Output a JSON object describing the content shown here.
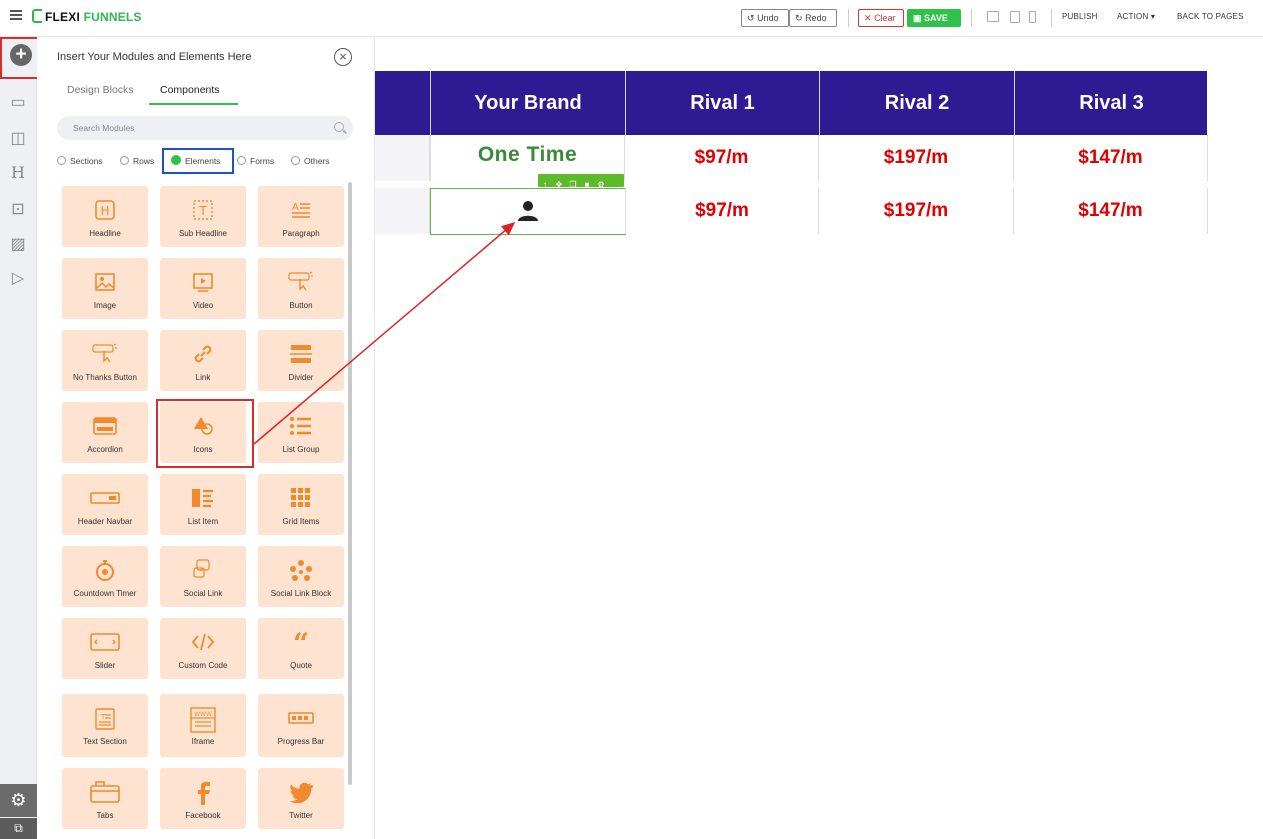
{
  "topbar": {
    "logo_flexi": "FLEXI",
    "logo_funnels": "FUNNELS",
    "undo": "Undo",
    "redo": "Redo",
    "clear": "Clear",
    "save": "SAVE",
    "publish": "PUBLISH",
    "action": "ACTION",
    "back": "BACK TO PAGES"
  },
  "panel": {
    "title": "Insert Your Modules and Elements Here",
    "tabs": [
      "Design Blocks",
      "Components"
    ],
    "active_tab": "Components",
    "search_placeholder": "Search Modules",
    "filters": [
      "Sections",
      "Rows",
      "Elements",
      "Forms",
      "Others"
    ],
    "active_filter": "Elements",
    "modules": [
      {
        "label": "Headline",
        "icon": "headline-icon"
      },
      {
        "label": "Sub Headline",
        "icon": "sub-headline-icon"
      },
      {
        "label": "Paragraph",
        "icon": "paragraph-icon"
      },
      {
        "label": "Image",
        "icon": "image-icon"
      },
      {
        "label": "Video",
        "icon": "video-icon"
      },
      {
        "label": "Button",
        "icon": "button-icon"
      },
      {
        "label": "No Thanks Button",
        "icon": "no-thanks-button-icon"
      },
      {
        "label": "Link",
        "icon": "link-icon"
      },
      {
        "label": "Divider",
        "icon": "divider-icon"
      },
      {
        "label": "Accordion",
        "icon": "accordion-icon"
      },
      {
        "label": "Icons",
        "icon": "shapes-icon"
      },
      {
        "label": "List Group",
        "icon": "list-group-icon"
      },
      {
        "label": "Header Navbar",
        "icon": "header-navbar-icon"
      },
      {
        "label": "List Item",
        "icon": "list-item-icon"
      },
      {
        "label": "Grid Items",
        "icon": "grid-icon"
      },
      {
        "label": "Countdown Timer",
        "icon": "timer-icon"
      },
      {
        "label": "Social Link",
        "icon": "social-link-icon"
      },
      {
        "label": "Social Link Block",
        "icon": "social-link-block-icon"
      },
      {
        "label": "Slider",
        "icon": "slider-icon"
      },
      {
        "label": "Custom Code",
        "icon": "code-icon"
      },
      {
        "label": "Quote",
        "icon": "quote-icon"
      },
      {
        "label": "Text Section",
        "icon": "text-section-icon"
      },
      {
        "label": "Iframe",
        "icon": "iframe-icon"
      },
      {
        "label": "Progress Bar",
        "icon": "progress-bar-icon"
      },
      {
        "label": "Tabs",
        "icon": "tabs-icon"
      },
      {
        "label": "Facebook",
        "icon": "facebook-icon"
      },
      {
        "label": "Twitter",
        "icon": "twitter-icon"
      }
    ]
  },
  "table": {
    "headers": [
      "Your Brand",
      "Rival 1",
      "Rival 2",
      "Rival 3"
    ],
    "row1": [
      "One Time",
      "$97/m",
      "$197/m",
      "$147/m"
    ],
    "row2": [
      "",
      "$97/m",
      "$197/m",
      "$147/m"
    ]
  },
  "colors": {
    "header_bg": "#2e1a93",
    "price": "#e00000",
    "accent_green": "#2ec24a",
    "tile_bg": "#fde3d0",
    "icon_orange": "#f08a2c"
  }
}
